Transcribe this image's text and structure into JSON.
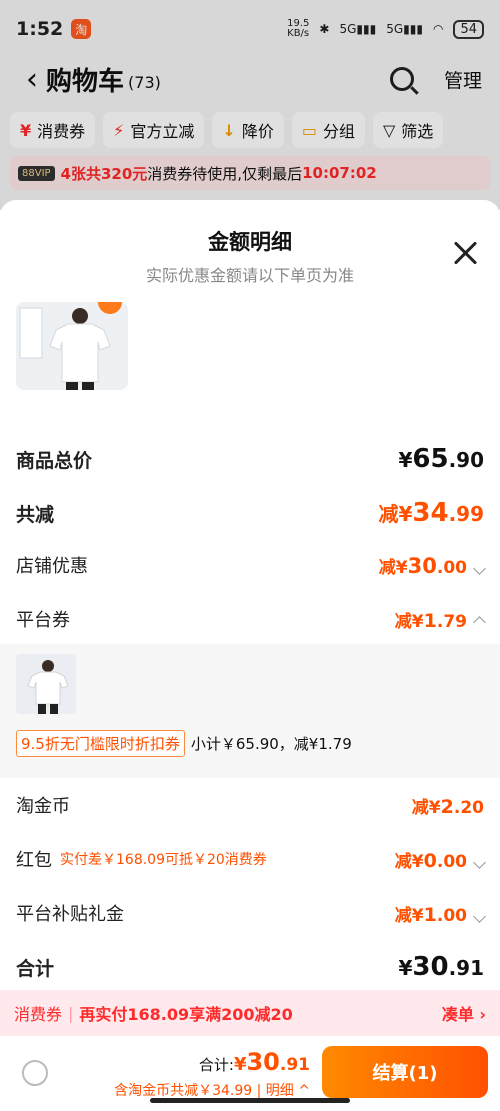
{
  "status": {
    "time": "1:52",
    "net_speed": "19.5\nKB/s",
    "battery": "54"
  },
  "cart": {
    "back": "‹",
    "title": "购物车",
    "count": "(73)",
    "manage": "管理"
  },
  "filters": [
    {
      "icon": "¥",
      "label": "消费券"
    },
    {
      "icon": "⚡",
      "label": "官方立减"
    },
    {
      "icon": "↓",
      "label": "降价"
    },
    {
      "icon": "▭",
      "label": "分组"
    },
    {
      "icon": "▽",
      "label": "筛选"
    }
  ],
  "promo": {
    "vip": "88VIP",
    "highlight": "4张共320元",
    "text": "消费券待使用,仅剩最后",
    "timer": "10:07:02"
  },
  "sheet": {
    "title": "金额明细",
    "subtitle": "实际优惠金额请以下单页为准",
    "rows": {
      "subtotal": {
        "label": "商品总价",
        "currency": "¥",
        "int": "65",
        "dec": ".90"
      },
      "total_reduce": {
        "label": "共减",
        "prefix": "减¥",
        "int": "34",
        "dec": ".99"
      },
      "store": {
        "label": "店铺优惠",
        "prefix": "减¥",
        "int": "30",
        "dec": ".00"
      },
      "platform": {
        "label": "平台券",
        "prefix": "减¥",
        "int": "1",
        "dec": ".79"
      },
      "coins": {
        "label": "淘金币",
        "prefix": "减¥",
        "int": "2",
        "dec": ".20"
      },
      "redpacket": {
        "label": "红包",
        "note": "实付差￥168.09可抵￥20消费券",
        "prefix": "减¥",
        "int": "0",
        "dec": ".00"
      },
      "gift": {
        "label": "平台补贴礼金",
        "prefix": "减¥",
        "int": "1",
        "dec": ".00"
      },
      "grand": {
        "label": "合计",
        "currency": "¥",
        "int": "30",
        "dec": ".91"
      }
    },
    "coupon": {
      "tag": "9.5折无门槛限时折扣券",
      "summary": "小计￥65.90，减¥1.79"
    }
  },
  "consume_bar": {
    "tag": "消费券",
    "main": "再实付168.09享满200减20",
    "action": "凑单 ›"
  },
  "checkout": {
    "total_label": "合计: ",
    "currency": "¥",
    "int": "30",
    "dec": ".91",
    "detail": "含淘金币共减￥34.99 | 明细 ^",
    "button": "结算(1)"
  },
  "colors": {
    "accent": "#ff5000",
    "red": "#ff2a2a"
  }
}
